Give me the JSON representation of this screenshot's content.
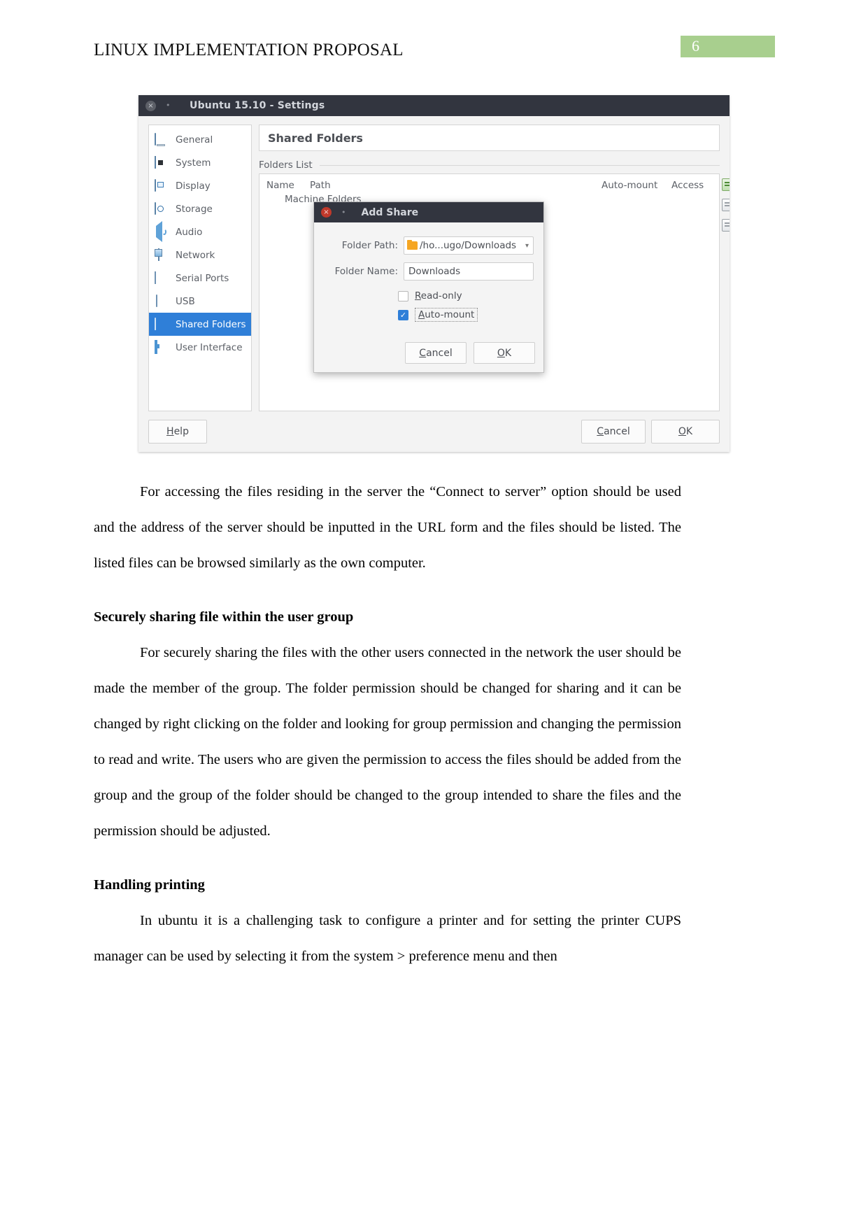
{
  "document": {
    "running_head": "LINUX IMPLEMENTATION PROPOSAL",
    "page_number": "6",
    "page_number_bg": "#a8cf8e"
  },
  "figure": {
    "window": {
      "title": "Ubuntu 15.10 - Settings",
      "close_glyph": "×",
      "minimize_glyph": "•",
      "sidebar": {
        "items": [
          {
            "label": "General",
            "icon": "monitor-icon",
            "selected": false
          },
          {
            "label": "System",
            "icon": "chip-icon",
            "selected": false
          },
          {
            "label": "Display",
            "icon": "display-icon",
            "selected": false
          },
          {
            "label": "Storage",
            "icon": "disk-icon",
            "selected": false
          },
          {
            "label": "Audio",
            "icon": "speaker-icon",
            "selected": false
          },
          {
            "label": "Network",
            "icon": "network-icon",
            "selected": false
          },
          {
            "label": "Serial Ports",
            "icon": "serial-port-icon",
            "selected": false
          },
          {
            "label": "USB",
            "icon": "usb-icon",
            "selected": false
          },
          {
            "label": "Shared Folders",
            "icon": "folder-icon",
            "selected": true
          },
          {
            "label": "User Interface",
            "icon": "user-interface-icon",
            "selected": false
          }
        ],
        "selected_bg": "#2f7fd8"
      },
      "pane": {
        "title": "Shared Folders",
        "group_label": "Folders List",
        "columns": {
          "name": "Name",
          "path": "Path",
          "auto_mount": "Auto-mount",
          "access": "Access"
        },
        "rows": [
          {
            "group": "Machine Folders"
          }
        ],
        "tools": [
          {
            "name": "add-shared-folder-icon"
          },
          {
            "name": "edit-shared-folder-icon"
          },
          {
            "name": "remove-shared-folder-icon"
          }
        ]
      },
      "buttons": {
        "help": "Help",
        "cancel": "Cancel",
        "ok": "OK"
      }
    },
    "dialog": {
      "title": "Add Share",
      "close_glyph": "×",
      "minimize_glyph": "•",
      "fields": [
        {
          "label": "Folder Path:",
          "value": "/ho...ugo/Downloads",
          "type": "combo"
        },
        {
          "label": "Folder Name:",
          "value": "Downloads",
          "type": "text"
        }
      ],
      "checkboxes": [
        {
          "label": "Read-only",
          "checked": false,
          "focused": false
        },
        {
          "label": "Auto-mount",
          "checked": true,
          "focused": true
        }
      ],
      "buttons": {
        "cancel": "Cancel",
        "ok": "OK"
      },
      "check_glyph": "✓"
    }
  },
  "body": {
    "paragraph_1": "For accessing the files residing in the server the “Connect to server” option should be used and the address of the server should be inputted in the URL form and the files should be listed. The listed files can be browsed similarly as the own computer.",
    "heading_1": "Securely sharing file within the user group",
    "paragraph_2": "For securely sharing the files with the other users connected in the network the user should be made the member of the group. The folder permission should be changed for sharing and it can be changed by right clicking on the folder and looking for group permission and changing the permission to read and write. The users who are given the permission to access the files should be added from the group and the group of the folder should be changed to the group intended to share the files and the permission should be adjusted.",
    "heading_2": "Handling printing",
    "paragraph_3": "In ubuntu it is a challenging task to configure a printer and for setting the printer CUPS manager can be used by selecting it from the system > preference menu and then"
  }
}
